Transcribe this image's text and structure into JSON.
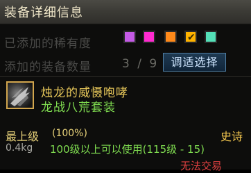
{
  "window": {
    "title": "装备详细信息"
  },
  "rarity_row": {
    "label": "已添加的稀有度",
    "swatches": [
      {
        "color": "#c55be6",
        "checked": false
      },
      {
        "color": "#ff2bd0",
        "checked": false
      },
      {
        "color": "#ff8a1a",
        "checked": false
      },
      {
        "color": "#ffb300",
        "checked": true
      },
      {
        "color": "#54e0b8",
        "checked": false
      }
    ]
  },
  "count_row": {
    "label": "添加的装备数量",
    "value": "3 / 9",
    "button_label": "调适选择"
  },
  "item": {
    "name": "烛龙的威慑咆哮",
    "set_name": "龙战八荒套装",
    "grade": "最上级",
    "grade_percent": "(100%)",
    "rarity": "史诗",
    "weight": "0.4kg",
    "requirement": "100级以上可以使用(115级 - 15)",
    "trade_status": "无法交易"
  }
}
